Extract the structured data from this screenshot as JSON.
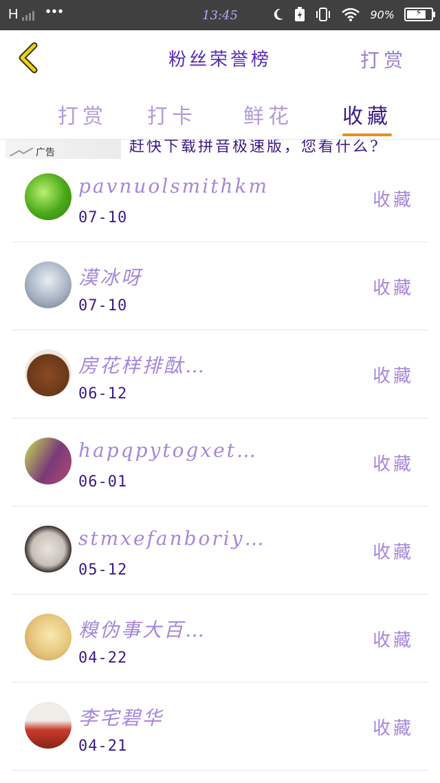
{
  "status_bar": {
    "network": "H",
    "time": "13:45",
    "battery_percent": "90%",
    "battery_level": 0.9,
    "icons": [
      "signal-icon",
      "more-dots-icon",
      "moon-icon",
      "charging-icon",
      "vibrate-icon",
      "wifi-icon",
      "battery-icon"
    ]
  },
  "header": {
    "title": "粉丝荣誉榜",
    "action_label": "打赏",
    "back_icon": "chevron-left-icon"
  },
  "tabs": [
    {
      "label": "打赏",
      "active": false
    },
    {
      "label": "打卡",
      "active": false
    },
    {
      "label": "鲜花",
      "active": false
    },
    {
      "label": "收藏",
      "active": true
    }
  ],
  "ad": {
    "label": "广告",
    "text": "赶快下载拼音极速版，您看什么?"
  },
  "entries": [
    {
      "name": "pavnuolsmithkm",
      "date": "07-10",
      "action": "收藏"
    },
    {
      "name": "漠冰呀",
      "date": "07-10",
      "action": "收藏"
    },
    {
      "name": "房花样排酞…",
      "date": "06-12",
      "action": "收藏"
    },
    {
      "name": "hapqpytogxet…",
      "date": "06-01",
      "action": "收藏"
    },
    {
      "name": "stmxefanboriy…",
      "date": "05-12",
      "action": "收藏"
    },
    {
      "name": "糗伪事大百…",
      "date": "04-22",
      "action": "收藏"
    },
    {
      "name": "李宅碧华",
      "date": "04-21",
      "action": "收藏"
    }
  ],
  "colors": {
    "accent_underline": "#e88c1e",
    "title": "#5a2ab8",
    "active_tab": "#3a1a88",
    "inactive_tab": "#b29ad8",
    "back_icon": "#e8d414"
  }
}
